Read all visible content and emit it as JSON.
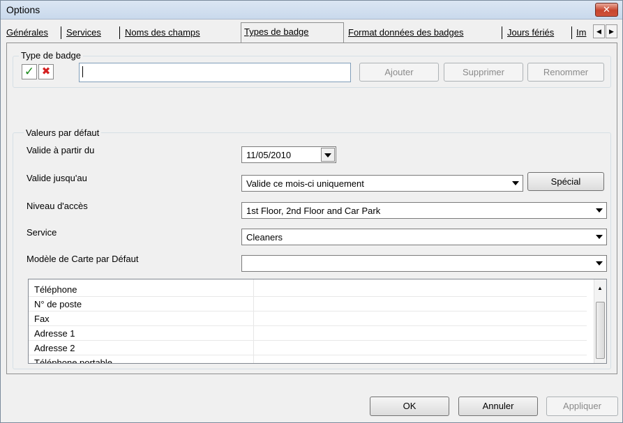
{
  "window": {
    "title": "Options",
    "close_label": "✕"
  },
  "tabs": [
    {
      "label": "Générales"
    },
    {
      "label": "Services"
    },
    {
      "label": "Noms des champs"
    },
    {
      "label": "Types de badge"
    },
    {
      "label": "Format données des badges"
    },
    {
      "label": "Jours fériés"
    },
    {
      "label": "Im"
    }
  ],
  "type_badge": {
    "group_title": "Type de badge",
    "accept_glyph": "✓",
    "cancel_glyph": "✖",
    "name_value": "",
    "add_label": "Ajouter",
    "delete_label": "Supprimer",
    "rename_label": "Renommer"
  },
  "defaults": {
    "group_title": "Valeurs par défaut",
    "valid_from_label": "Valide à partir du",
    "valid_from_value": "11/05/2010",
    "valid_until_label": "Valide jusqu'au",
    "valid_until_value": "Valide ce mois-ci uniquement",
    "special_label": "Spécial",
    "access_label": "Niveau d'accès",
    "access_value": "1st Floor, 2nd Floor and Car Park",
    "service_label": "Service",
    "service_value": "Cleaners",
    "card_model_label": "Modèle de Carte par Défaut",
    "card_model_value": ""
  },
  "fields_list": [
    "Téléphone",
    "N° de poste",
    "Fax",
    "Adresse 1",
    "Adresse 2",
    "Téléphone portable"
  ],
  "footer": {
    "ok_label": "OK",
    "cancel_label": "Annuler",
    "apply_label": "Appliquer"
  },
  "colors": {
    "accept": "#1a8a1a",
    "cancel": "#d42020",
    "close_button": "#c7452d"
  }
}
